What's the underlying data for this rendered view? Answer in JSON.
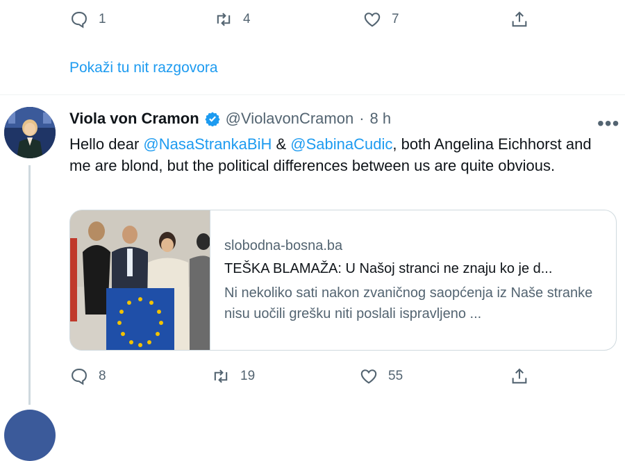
{
  "prev_tweet": {
    "actions": {
      "reply_count": "1",
      "retweet_count": "4",
      "like_count": "7"
    },
    "show_thread_label": "Pokaži tu nit razgovora"
  },
  "tweet": {
    "display_name": "Viola von Cramon",
    "handle": "@ViolavonCramon",
    "separator": "·",
    "time": "8 h",
    "more_label": "•••",
    "text_parts": {
      "p1": "Hello dear ",
      "mention1": "@NasaStrankaBiH",
      "p2": " & ",
      "mention2": "@SabinaCudic",
      "p3": ", both Angelina Eichhorst and me are blond, but the political differences between us are quite obvious."
    },
    "card": {
      "domain": "slobodna-bosna.ba",
      "title": "TEŠKA BLAMAŽA: U Našoj stranci ne znaju ko je d...",
      "description": "Ni nekoliko sati nakon zvaničnog saopćenja iz Naše stranke nisu uočili grešku niti poslali ispravljeno ..."
    },
    "actions": {
      "reply_count": "8",
      "retweet_count": "19",
      "like_count": "55"
    }
  },
  "colors": {
    "accent": "#1d9bf0",
    "muted": "#536471",
    "verified": "#1d9bf0"
  }
}
